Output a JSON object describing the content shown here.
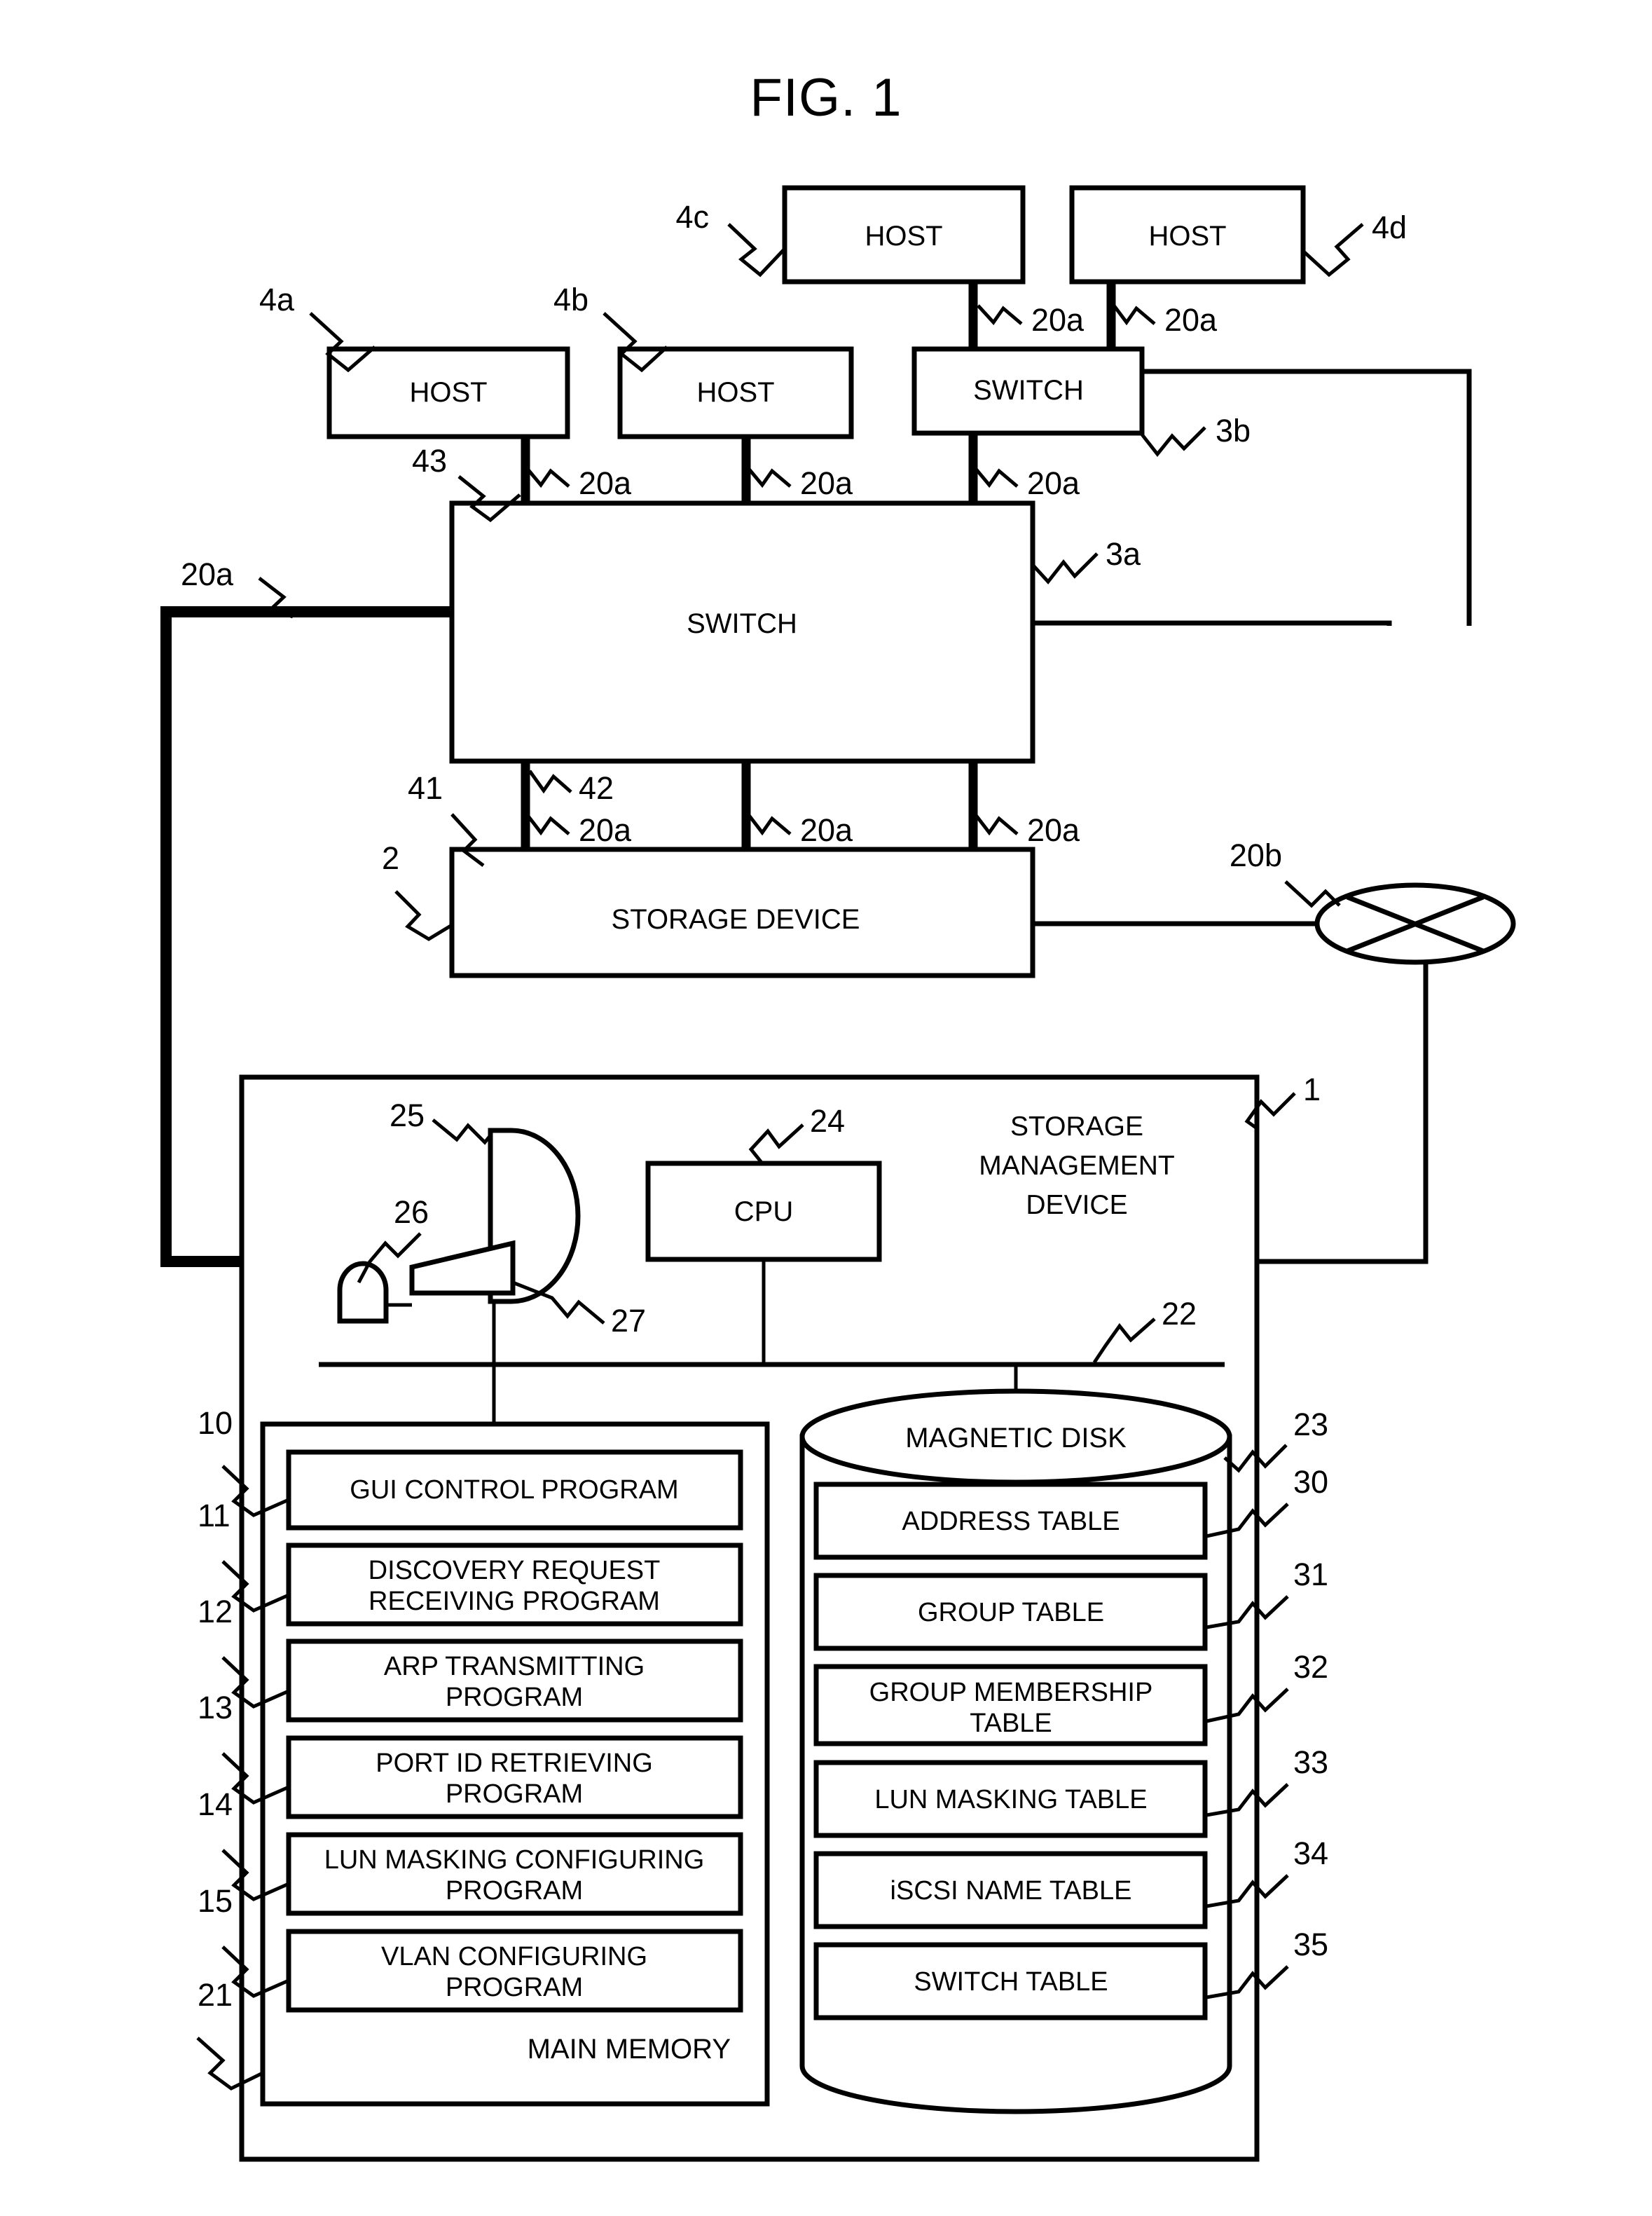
{
  "figure": {
    "title": "FIG. 1",
    "domain_note": "patent block diagram"
  },
  "nodes": {
    "host_4a": "HOST",
    "host_4b": "HOST",
    "host_4c": "HOST",
    "host_4d": "HOST",
    "switch_3b": "SWITCH",
    "switch_3a": "SWITCH",
    "storage_device": "STORAGE DEVICE",
    "storage_mgmt_device_l1": "STORAGE",
    "storage_mgmt_device_l2": "MANAGEMENT",
    "storage_mgmt_device_l3": "DEVICE",
    "cpu": "CPU",
    "main_memory": "MAIN MEMORY",
    "magnetic_disk": "MAGNETIC DISK"
  },
  "main_memory_programs": [
    {
      "ref": "10",
      "label": "GUI CONTROL PROGRAM",
      "lines": [
        "GUI CONTROL PROGRAM"
      ]
    },
    {
      "ref": "11",
      "label": "DISCOVERY REQUEST RECEIVING PROGRAM",
      "lines": [
        "DISCOVERY REQUEST",
        "RECEIVING PROGRAM"
      ]
    },
    {
      "ref": "12",
      "label": "ARP TRANSMITTING PROGRAM",
      "lines": [
        "ARP TRANSMITTING",
        "PROGRAM"
      ]
    },
    {
      "ref": "13",
      "label": "PORT ID RETRIEVING PROGRAM",
      "lines": [
        "PORT ID RETRIEVING",
        "PROGRAM"
      ]
    },
    {
      "ref": "14",
      "label": "LUN MASKING CONFIGURING PROGRAM",
      "lines": [
        "LUN MASKING CONFIGURING",
        "PROGRAM"
      ]
    },
    {
      "ref": "15",
      "label": "VLAN CONFIGURING PROGRAM",
      "lines": [
        "VLAN CONFIGURING",
        "PROGRAM"
      ]
    }
  ],
  "magnetic_disk_tables": [
    {
      "ref": "30",
      "label": "ADDRESS TABLE",
      "lines": [
        "ADDRESS TABLE"
      ]
    },
    {
      "ref": "31",
      "label": "GROUP TABLE",
      "lines": [
        "GROUP TABLE"
      ]
    },
    {
      "ref": "32",
      "label": "GROUP MEMBERSHIP TABLE",
      "lines": [
        "GROUP MEMBERSHIP",
        "TABLE"
      ]
    },
    {
      "ref": "33",
      "label": "LUN MASKING TABLE",
      "lines": [
        "LUN MASKING TABLE"
      ]
    },
    {
      "ref": "34",
      "label": "iSCSI NAME TABLE",
      "lines": [
        "iSCSI NAME TABLE"
      ]
    },
    {
      "ref": "35",
      "label": "SWITCH TABLE",
      "lines": [
        "SWITCH TABLE"
      ]
    }
  ],
  "reference_numerals": {
    "n1": "1",
    "n2": "2",
    "n3a": "3a",
    "n3b": "3b",
    "n4a": "4a",
    "n4b": "4b",
    "n4c": "4c",
    "n4d": "4d",
    "n20a_1": "20a",
    "n20a_2": "20a",
    "n20a_3": "20a",
    "n20a_4": "20a",
    "n20a_5": "20a",
    "n20a_6": "20a",
    "n20a_7": "20a",
    "n20a_8": "20a",
    "n20a_9": "20a",
    "n20b": "20b",
    "n21": "21",
    "n22": "22",
    "n23": "23",
    "n24": "24",
    "n25": "25",
    "n26": "26",
    "n27": "27",
    "n41": "41",
    "n42": "42",
    "n43": "43"
  },
  "peripherals": {
    "display_ref": "25",
    "mouse_ref": "26",
    "keyboard_ref": "27",
    "display_icon": "monitor-icon",
    "mouse_icon": "mouse-icon",
    "keyboard_icon": "keyboard-icon",
    "network_icon": "network-cloud-icon"
  },
  "colors": {
    "line": "#000000",
    "fill": "#ffffff"
  }
}
